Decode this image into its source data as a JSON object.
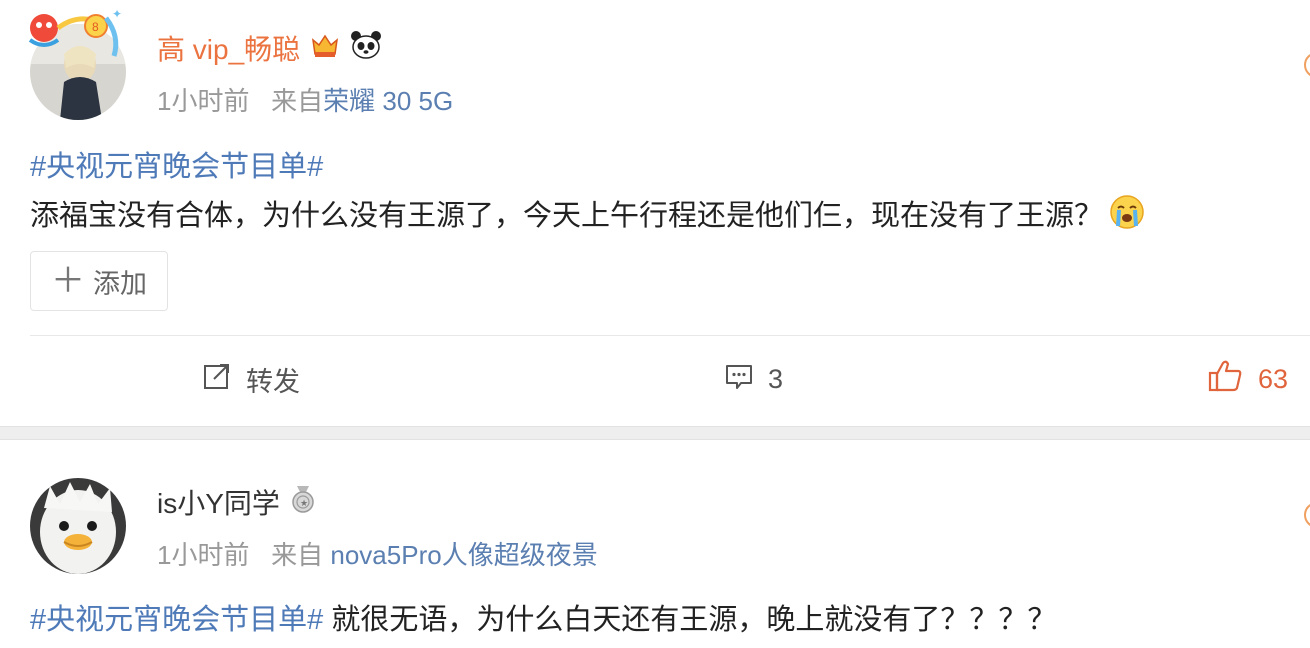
{
  "posts": [
    {
      "username": "高 vip_畅聪",
      "time": "1小时前",
      "from_prefix": "来自",
      "source": "荣耀 30 5G",
      "topic": "#央视元宵晚会节目单#",
      "text": "添福宝没有合体，为什么没有王源了，今天上午行程还是他们仨，现在没有了王源？",
      "add_label": "添加",
      "repost_label": "转发",
      "comment_count": "3",
      "like_count": "63",
      "icons": [
        "crown-badge-icon",
        "panda-badge-icon",
        "crying-emoji-icon",
        "repost-icon",
        "comment-icon",
        "thumbs-up-icon"
      ]
    },
    {
      "username": "is小Y同学",
      "time": "1小时前",
      "from_prefix": "来自",
      "source": "nova5Pro人像超级夜景",
      "topic": "#央视元宵晚会节目单#",
      "text": " 就很无语，为什么白天还有王源，晚上就没有了？？？？",
      "icons": [
        "medal-badge-icon"
      ]
    }
  ],
  "colors": {
    "username_vip": "#eb7340",
    "link": "#4f7ab8",
    "like": "#e0643c",
    "meta": "#999999"
  }
}
